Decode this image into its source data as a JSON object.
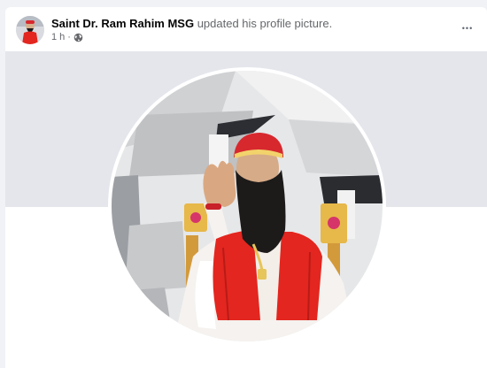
{
  "post": {
    "author": "Saint Dr. Ram Rahim MSG",
    "action": " updated his profile picture.",
    "time": "1 h",
    "separator": "·",
    "privacy_icon": "globe-icon",
    "more_icon": "more-horizontal-icon",
    "more_label": "•••"
  },
  "colors": {
    "cover": "#e4e6eb",
    "vest": "#e3261f",
    "turban": "#d7282e",
    "beard": "#1d1a1a",
    "robe": "#f5f2ef"
  }
}
